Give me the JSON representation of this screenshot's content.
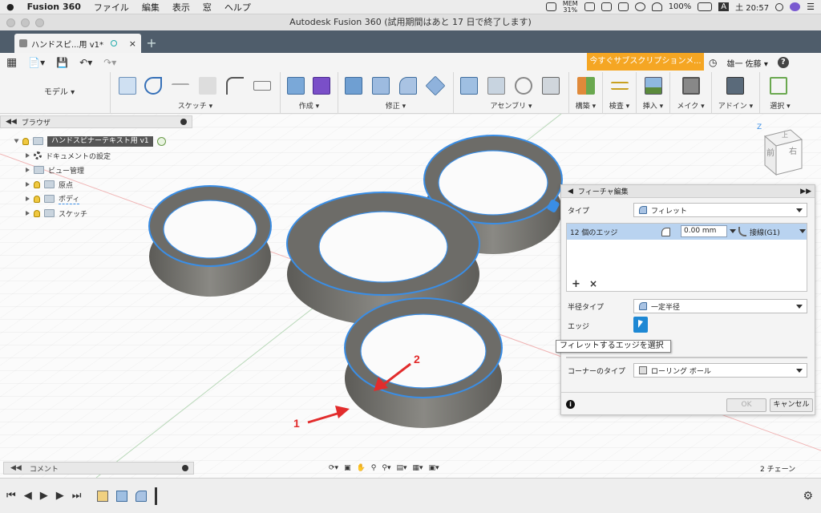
{
  "menubar": {
    "apple": "",
    "app_name": "Fusion 360",
    "items": [
      "ファイル",
      "編集",
      "表示",
      "窓",
      "ヘルプ"
    ],
    "mem_label": "MEM",
    "mem_value": "31%",
    "battery": "100%",
    "input": "A",
    "clock": "土 20:57"
  },
  "window": {
    "title": "Autodesk Fusion 360 (試用期間はあと 17 日で終了します)"
  },
  "tab": {
    "label": "ハンドスピ...用 v1*",
    "close": "×",
    "new_tab": "+"
  },
  "header": {
    "subscription_button": "今すぐサブスクリプションメ...",
    "user": "雄一 佐藤 ▾",
    "help": "?"
  },
  "toolbar": {
    "workspace": "モデル",
    "groups": [
      "スケッチ ▾",
      "作成 ▾",
      "修正 ▾",
      "アセンブリ ▾",
      "構築 ▾",
      "検査 ▾",
      "挿入 ▾",
      "メイク ▾",
      "アドイン ▾",
      "選択 ▾"
    ]
  },
  "browser": {
    "title": "ブラウザ",
    "root": "ハンドスピナーテキスト用 v1",
    "nodes": [
      "ドキュメントの設定",
      "ビュー管理",
      "原点",
      "ボディ",
      "スケッチ"
    ]
  },
  "viewcube": {
    "front": "前",
    "right": "右",
    "top": "上",
    "axis_z": "Z"
  },
  "panel": {
    "title": "フィーチャ編集",
    "type_label": "タイプ",
    "type_value": "フィレット",
    "edges_count": "12 個のエッジ",
    "radius": "0.00 mm",
    "continuity": "接線(G1)",
    "add": "+",
    "remove": "×",
    "radius_type_label": "半径タイプ",
    "radius_type_value": "一定半径",
    "edge_label": "エッジ",
    "tooltip": "フィレットするエッジを選択",
    "corner_label": "コーナーのタイプ",
    "corner_value": "ローリング ボール",
    "ok": "OK",
    "cancel": "キャンセル",
    "info": "i"
  },
  "annotations": {
    "label_1": "1",
    "label_2": "2"
  },
  "bottom": {
    "comment": "コメント",
    "chains": "2 チェーン"
  },
  "colors": {
    "tabbar": "#4f5d6b",
    "accent_orange": "#f5a623",
    "selection_blue": "#3a8ee6",
    "annotation_red": "#e22c2c",
    "body_gray": "#6b6a66"
  }
}
